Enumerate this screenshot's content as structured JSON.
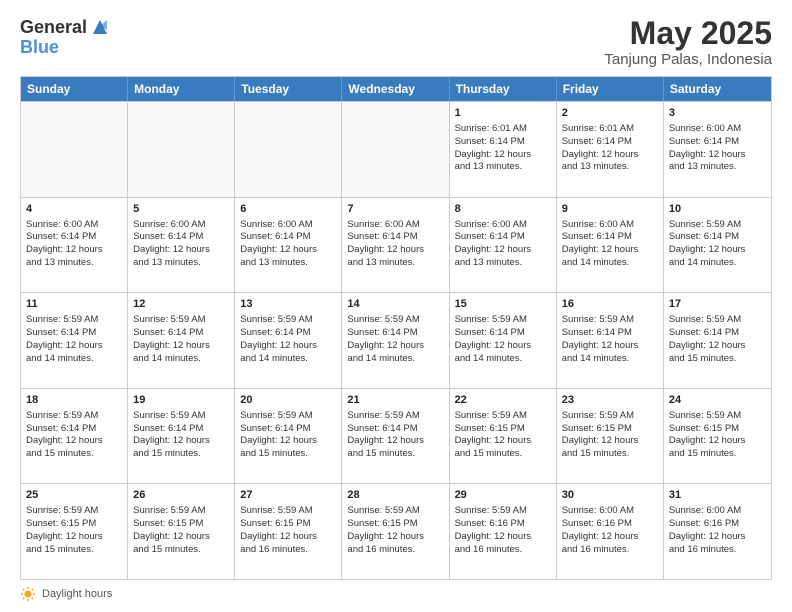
{
  "header": {
    "logo_general": "General",
    "logo_blue": "Blue",
    "title": "May 2025",
    "subtitle": "Tanjung Palas, Indonesia"
  },
  "calendar": {
    "days_of_week": [
      "Sunday",
      "Monday",
      "Tuesday",
      "Wednesday",
      "Thursday",
      "Friday",
      "Saturday"
    ],
    "weeks": [
      [
        {
          "day": "",
          "empty": true
        },
        {
          "day": "",
          "empty": true
        },
        {
          "day": "",
          "empty": true
        },
        {
          "day": "",
          "empty": true
        },
        {
          "day": "1",
          "lines": [
            "Sunrise: 6:01 AM",
            "Sunset: 6:14 PM",
            "Daylight: 12 hours",
            "and 13 minutes."
          ]
        },
        {
          "day": "2",
          "lines": [
            "Sunrise: 6:01 AM",
            "Sunset: 6:14 PM",
            "Daylight: 12 hours",
            "and 13 minutes."
          ]
        },
        {
          "day": "3",
          "lines": [
            "Sunrise: 6:00 AM",
            "Sunset: 6:14 PM",
            "Daylight: 12 hours",
            "and 13 minutes."
          ]
        }
      ],
      [
        {
          "day": "4",
          "lines": [
            "Sunrise: 6:00 AM",
            "Sunset: 6:14 PM",
            "Daylight: 12 hours",
            "and 13 minutes."
          ]
        },
        {
          "day": "5",
          "lines": [
            "Sunrise: 6:00 AM",
            "Sunset: 6:14 PM",
            "Daylight: 12 hours",
            "and 13 minutes."
          ]
        },
        {
          "day": "6",
          "lines": [
            "Sunrise: 6:00 AM",
            "Sunset: 6:14 PM",
            "Daylight: 12 hours",
            "and 13 minutes."
          ]
        },
        {
          "day": "7",
          "lines": [
            "Sunrise: 6:00 AM",
            "Sunset: 6:14 PM",
            "Daylight: 12 hours",
            "and 13 minutes."
          ]
        },
        {
          "day": "8",
          "lines": [
            "Sunrise: 6:00 AM",
            "Sunset: 6:14 PM",
            "Daylight: 12 hours",
            "and 13 minutes."
          ]
        },
        {
          "day": "9",
          "lines": [
            "Sunrise: 6:00 AM",
            "Sunset: 6:14 PM",
            "Daylight: 12 hours",
            "and 14 minutes."
          ]
        },
        {
          "day": "10",
          "lines": [
            "Sunrise: 5:59 AM",
            "Sunset: 6:14 PM",
            "Daylight: 12 hours",
            "and 14 minutes."
          ]
        }
      ],
      [
        {
          "day": "11",
          "lines": [
            "Sunrise: 5:59 AM",
            "Sunset: 6:14 PM",
            "Daylight: 12 hours",
            "and 14 minutes."
          ]
        },
        {
          "day": "12",
          "lines": [
            "Sunrise: 5:59 AM",
            "Sunset: 6:14 PM",
            "Daylight: 12 hours",
            "and 14 minutes."
          ]
        },
        {
          "day": "13",
          "lines": [
            "Sunrise: 5:59 AM",
            "Sunset: 6:14 PM",
            "Daylight: 12 hours",
            "and 14 minutes."
          ]
        },
        {
          "day": "14",
          "lines": [
            "Sunrise: 5:59 AM",
            "Sunset: 6:14 PM",
            "Daylight: 12 hours",
            "and 14 minutes."
          ]
        },
        {
          "day": "15",
          "lines": [
            "Sunrise: 5:59 AM",
            "Sunset: 6:14 PM",
            "Daylight: 12 hours",
            "and 14 minutes."
          ]
        },
        {
          "day": "16",
          "lines": [
            "Sunrise: 5:59 AM",
            "Sunset: 6:14 PM",
            "Daylight: 12 hours",
            "and 14 minutes."
          ]
        },
        {
          "day": "17",
          "lines": [
            "Sunrise: 5:59 AM",
            "Sunset: 6:14 PM",
            "Daylight: 12 hours",
            "and 15 minutes."
          ]
        }
      ],
      [
        {
          "day": "18",
          "lines": [
            "Sunrise: 5:59 AM",
            "Sunset: 6:14 PM",
            "Daylight: 12 hours",
            "and 15 minutes."
          ]
        },
        {
          "day": "19",
          "lines": [
            "Sunrise: 5:59 AM",
            "Sunset: 6:14 PM",
            "Daylight: 12 hours",
            "and 15 minutes."
          ]
        },
        {
          "day": "20",
          "lines": [
            "Sunrise: 5:59 AM",
            "Sunset: 6:14 PM",
            "Daylight: 12 hours",
            "and 15 minutes."
          ]
        },
        {
          "day": "21",
          "lines": [
            "Sunrise: 5:59 AM",
            "Sunset: 6:14 PM",
            "Daylight: 12 hours",
            "and 15 minutes."
          ]
        },
        {
          "day": "22",
          "lines": [
            "Sunrise: 5:59 AM",
            "Sunset: 6:15 PM",
            "Daylight: 12 hours",
            "and 15 minutes."
          ]
        },
        {
          "day": "23",
          "lines": [
            "Sunrise: 5:59 AM",
            "Sunset: 6:15 PM",
            "Daylight: 12 hours",
            "and 15 minutes."
          ]
        },
        {
          "day": "24",
          "lines": [
            "Sunrise: 5:59 AM",
            "Sunset: 6:15 PM",
            "Daylight: 12 hours",
            "and 15 minutes."
          ]
        }
      ],
      [
        {
          "day": "25",
          "lines": [
            "Sunrise: 5:59 AM",
            "Sunset: 6:15 PM",
            "Daylight: 12 hours",
            "and 15 minutes."
          ]
        },
        {
          "day": "26",
          "lines": [
            "Sunrise: 5:59 AM",
            "Sunset: 6:15 PM",
            "Daylight: 12 hours",
            "and 15 minutes."
          ]
        },
        {
          "day": "27",
          "lines": [
            "Sunrise: 5:59 AM",
            "Sunset: 6:15 PM",
            "Daylight: 12 hours",
            "and 16 minutes."
          ]
        },
        {
          "day": "28",
          "lines": [
            "Sunrise: 5:59 AM",
            "Sunset: 6:15 PM",
            "Daylight: 12 hours",
            "and 16 minutes."
          ]
        },
        {
          "day": "29",
          "lines": [
            "Sunrise: 5:59 AM",
            "Sunset: 6:16 PM",
            "Daylight: 12 hours",
            "and 16 minutes."
          ]
        },
        {
          "day": "30",
          "lines": [
            "Sunrise: 6:00 AM",
            "Sunset: 6:16 PM",
            "Daylight: 12 hours",
            "and 16 minutes."
          ]
        },
        {
          "day": "31",
          "lines": [
            "Sunrise: 6:00 AM",
            "Sunset: 6:16 PM",
            "Daylight: 12 hours",
            "and 16 minutes."
          ]
        }
      ]
    ]
  },
  "footer": {
    "label": "Daylight hours"
  }
}
